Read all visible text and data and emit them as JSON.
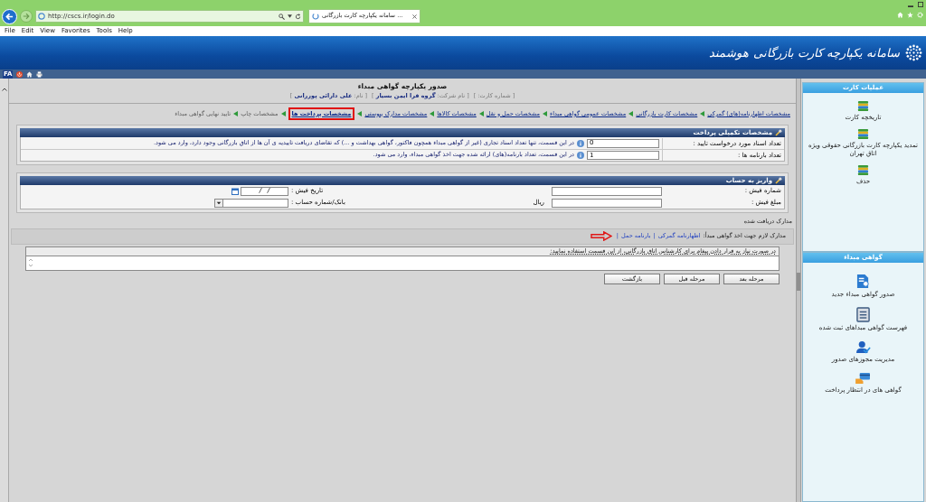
{
  "browser": {
    "url": "http://cscs.ir/login.do",
    "tab_title": "سامانه یکپارچه کارت بازرگانی ...",
    "menu": {
      "file": "File",
      "edit": "Edit",
      "view": "View",
      "favorites": "Favorites",
      "tools": "Tools",
      "help": "Help"
    }
  },
  "site_header": {
    "title": "سامانه یکپارچه کارت بازرگانی هوشمند"
  },
  "toolbar": {
    "language": "FA"
  },
  "page": {
    "title": "صدور یکپارچه گواهی مبداء",
    "info": [
      "[ شماره کارت: ]",
      "[ نام شرکت: **گروه فرا ایمن بسیار** ]",
      "[ نام: **علی دارائی پوررانی** ]"
    ]
  },
  "steps": [
    {
      "label": "مشخصات اظهارنامه(های) گمرکی",
      "selected": false,
      "disabled": false
    },
    {
      "label": "مشخصات کارت بازرگانی",
      "selected": false,
      "disabled": false
    },
    {
      "label": "مشخصات عمومی گواهی مبداء",
      "selected": false,
      "disabled": false
    },
    {
      "label": "مشخصات حمل و نقل",
      "selected": false,
      "disabled": false
    },
    {
      "label": "مشخصات کالاها",
      "selected": false,
      "disabled": false
    },
    {
      "label": "مشخصات مدارک پیوستی",
      "selected": false,
      "disabled": false
    },
    {
      "label": "مشخصات پرداخت ها",
      "selected": true,
      "disabled": false
    },
    {
      "label": "مشخصات چاپ",
      "selected": false,
      "disabled": true
    },
    {
      "label": "تایید نهایی گواهی مبداء",
      "selected": false,
      "disabled": true
    }
  ],
  "payment_details": {
    "title": "مشخصات تکمیلی پرداخت",
    "rows": [
      {
        "label": "تعداد اسناد مورد درخواست تایید :",
        "value": "0",
        "hint": "در این قسمت، تنها تعداد اسناد تجاری (غیر از گواهی مبداء همچون فاکتور، گواهی بهداشت و ...) که تقاضای دریافت تاییدیه ی آن ها از اتاق بازرگانی وجود دارد، وارد می شود."
      },
      {
        "label": "تعداد بارنامه ها :",
        "value": "1",
        "hint": "در این قسمت، تعداد بارنامه(های) ارائه شده جهت اخذ گواهی مبداء، وارد می شود."
      }
    ]
  },
  "deposit": {
    "title": "واریز به حساب",
    "fields": [
      {
        "kind": "text",
        "label": "شماره فیش :"
      },
      {
        "kind": "date",
        "label": "تاریخ فیش :",
        "value": "/   /"
      },
      {
        "kind": "amount",
        "label": "مبلغ فیش :",
        "unit": "ریال"
      },
      {
        "kind": "select",
        "label": "بانک/شماره حساب :"
      }
    ]
  },
  "documents": {
    "title": "مدارک دریافت شده",
    "required_label": "مدارک لازم جهت اخذ گواهی مبدأ:",
    "links": [
      "اظهارنامه گمرکی",
      "بارنامه حمل"
    ],
    "separator": "|"
  },
  "message": {
    "label": "در صورت نیاز به قرار دادن پیغام برای کارشناس اتاق بازرگانی، از این قسمت استفاده نمایید:"
  },
  "buttons": [
    "مرحله بعد",
    "مرحله قبل",
    "بازگشت"
  ],
  "sidebar": [
    {
      "title": "عملیات کارت",
      "items": [
        {
          "kind": "books",
          "label": "تاریخچه کارت"
        },
        {
          "kind": "books",
          "label": "تمدید یکپارچه کارت بازرگانی حقوقی ویژه اتاق تهران"
        },
        {
          "kind": "books",
          "label": "حذف"
        }
      ]
    },
    {
      "title": "گواهی مبداء",
      "items": [
        {
          "kind": "document",
          "label": "صدور گواهی مبداء جدید"
        },
        {
          "kind": "list",
          "label": "فهرست گواهی مبداهای ثبت شده"
        },
        {
          "kind": "user-check",
          "label": "مدیریت مجوزهای صدور"
        },
        {
          "kind": "card",
          "label": "گواهی های در انتظار پرداخت"
        }
      ]
    }
  ]
}
